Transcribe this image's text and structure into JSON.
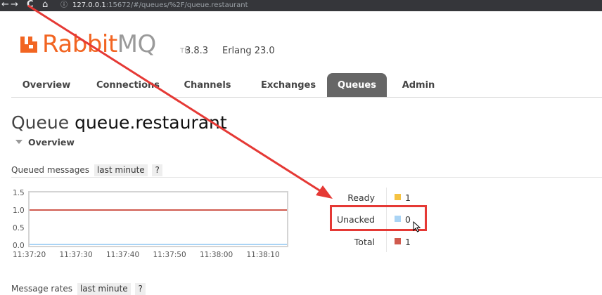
{
  "browser": {
    "url_host": "127.0.0.1",
    "url_rest": ":15672/#/queues/%2F/queue.restaurant",
    "back_glyph": "←",
    "forward_glyph": "→",
    "reload_glyph": "C",
    "home_glyph": "⌂",
    "info_glyph": "ⓘ"
  },
  "header": {
    "logo_rabbit": "Rabbit",
    "logo_mq": "MQ",
    "logo_tm": "TM",
    "version": "3.8.3",
    "erlang": "Erlang 23.0"
  },
  "tabs": [
    {
      "label": "Overview",
      "active": false
    },
    {
      "label": "Connections",
      "active": false
    },
    {
      "label": "Channels",
      "active": false
    },
    {
      "label": "Exchanges",
      "active": false
    },
    {
      "label": "Queues",
      "active": true
    },
    {
      "label": "Admin",
      "active": false
    }
  ],
  "page": {
    "title_prefix": "Queue",
    "queue_name": "queue.restaurant",
    "section_label": "Overview"
  },
  "queued_messages": {
    "label": "Queued messages",
    "range": "last minute",
    "help": "?"
  },
  "message_rates": {
    "label": "Message rates",
    "range": "last minute",
    "help": "?"
  },
  "chart_data": {
    "type": "line",
    "y_ticks": [
      "1.5",
      "1.0",
      "0.5",
      "0.0"
    ],
    "ylim": [
      0,
      1.5
    ],
    "x": [
      "11:37:20",
      "11:37:30",
      "11:37:40",
      "11:37:50",
      "11:38:00",
      "11:38:10"
    ],
    "series": [
      {
        "name": "Ready",
        "color": "#f5c242",
        "values": [
          1,
          1,
          1,
          1,
          1,
          1
        ]
      },
      {
        "name": "Unacked",
        "color": "#aad4f5",
        "values": [
          0,
          0,
          0,
          0,
          0,
          0
        ]
      },
      {
        "name": "Total",
        "color": "#d05a4e",
        "values": [
          1,
          1,
          1,
          1,
          1,
          1
        ]
      }
    ]
  },
  "legend": [
    {
      "label": "Ready",
      "value": "1",
      "color": "#f5c242"
    },
    {
      "label": "Unacked",
      "value": "0",
      "color": "#aad4f5"
    },
    {
      "label": "Total",
      "value": "1",
      "color": "#d05a4e"
    }
  ],
  "annotation_color": "#e53935"
}
